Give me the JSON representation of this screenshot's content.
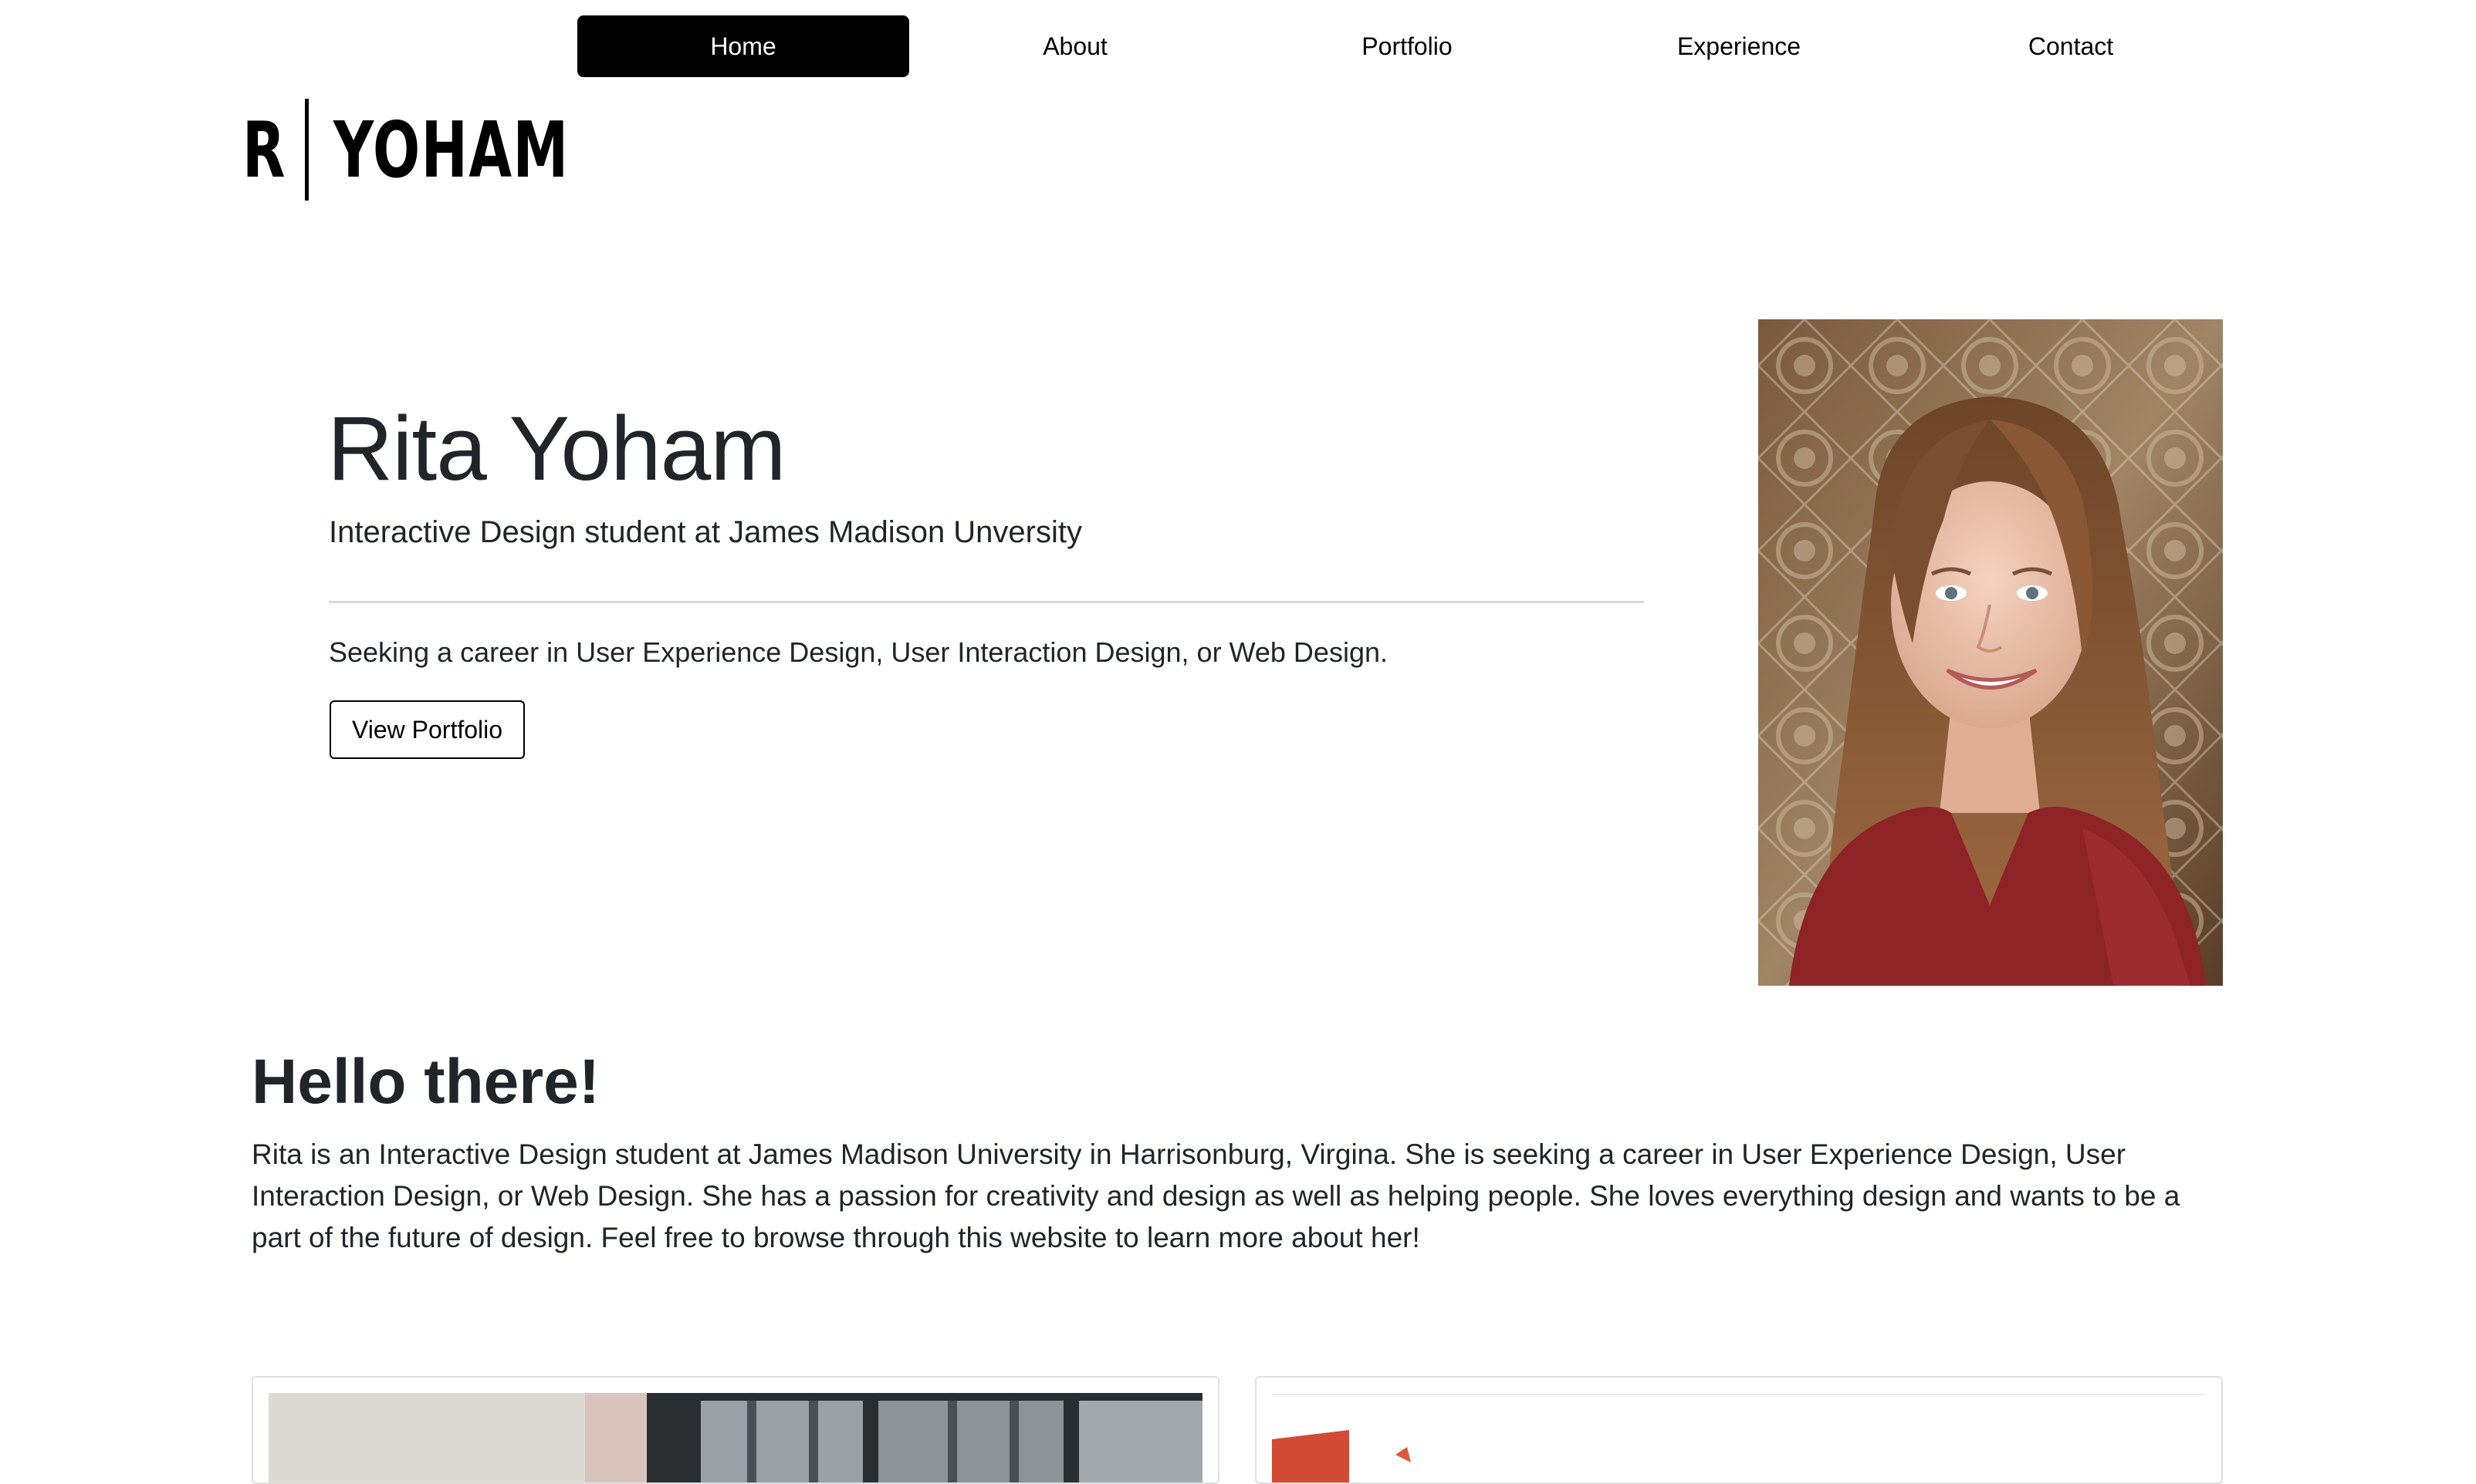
{
  "nav": {
    "items": [
      {
        "label": "Home",
        "active": true
      },
      {
        "label": "About",
        "active": false
      },
      {
        "label": "Portfolio",
        "active": false
      },
      {
        "label": "Experience",
        "active": false
      },
      {
        "label": "Contact",
        "active": false
      }
    ]
  },
  "logo": {
    "initial": "R",
    "surname": "YOHAM"
  },
  "hero": {
    "title": "Rita Yoham",
    "subtitle": "Interactive Design student at James Madison Unversity",
    "tagline": "Seeking a career in User Experience Design, User Interaction Design, or Web Design.",
    "button_label": "View Portfolio"
  },
  "about": {
    "heading": "Hello there!",
    "text": "Rita is an Interactive Design student at James Madison University in Harrisonburg, Virgina. She is seeking a career in User Experience Design, User Interaction Design, or Web Design. She has a passion for creativity and design as well as helping people. She loves everything design and wants to be a part of the future of design. Feel free to browse through this website to learn more about her!"
  },
  "colors": {
    "nav_active_bg": "#000000",
    "text": "#212529",
    "rule": "#d9d9d9",
    "card_border": "#dfdfdf"
  }
}
